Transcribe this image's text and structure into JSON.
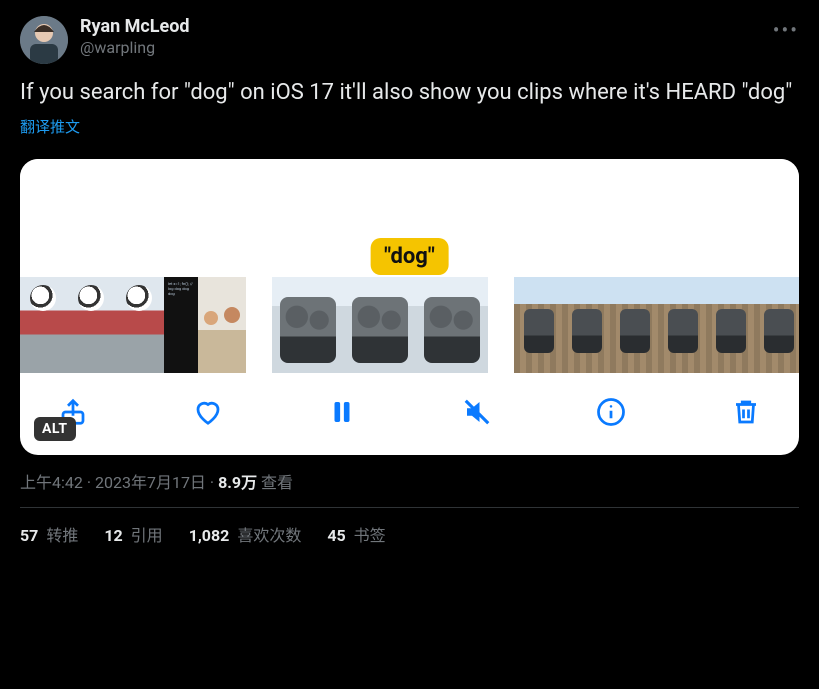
{
  "author": {
    "display_name": "Ryan McLeod",
    "handle": "@warpling"
  },
  "body_text": "If you search for \"dog\" on iOS 17 it'll also show you clips where it's HEARD \"dog\"",
  "translate_label": "翻译推文",
  "media": {
    "bubble_text": "\"dog\"",
    "alt_badge": "ALT",
    "toolbar_icons": [
      "share",
      "heart",
      "pause",
      "mute",
      "info",
      "trash"
    ]
  },
  "meta": {
    "time": "上午4:42",
    "separator_dot": " · ",
    "date": "2023年7月17日",
    "views_count": "8.9万",
    "views_label": " 查看"
  },
  "stats": {
    "retweets_count": "57",
    "retweets_label": " 转推",
    "quotes_count": "12",
    "quotes_label": " 引用",
    "likes_count": "1,082",
    "likes_label": " 喜欢次数",
    "bookmarks_count": "45",
    "bookmarks_label": " 书签"
  }
}
